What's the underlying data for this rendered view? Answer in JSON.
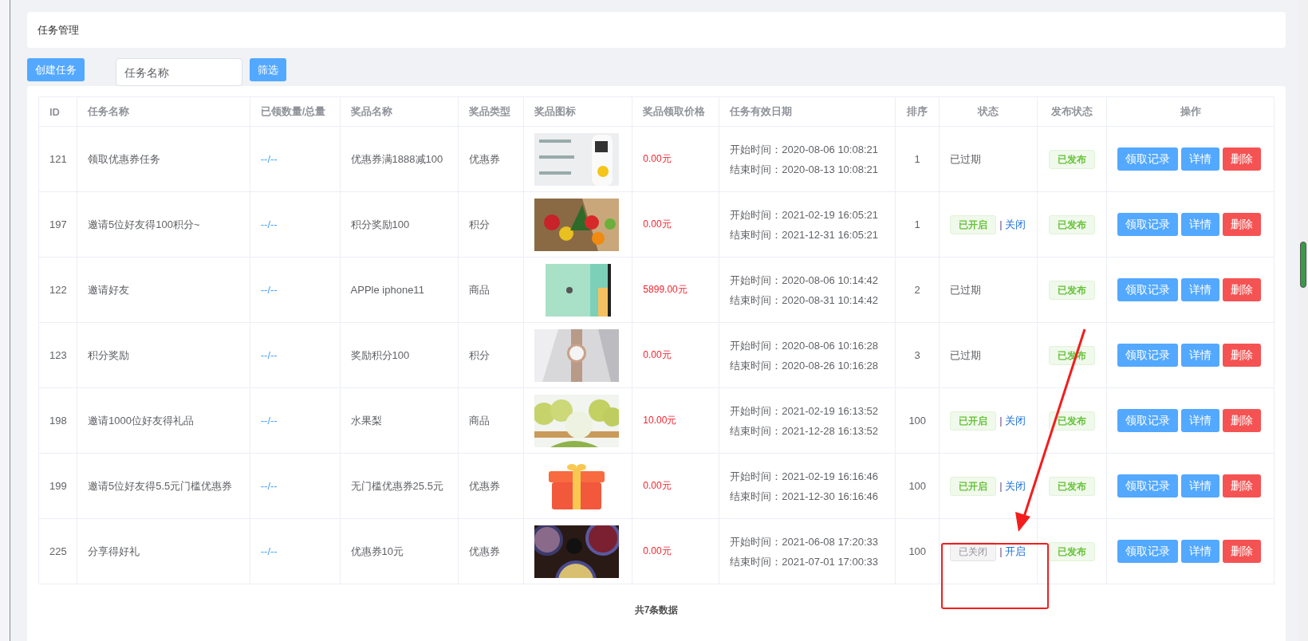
{
  "page_title": "任务管理",
  "toolbar": {
    "create_button": "创建任务",
    "search": {
      "placeholder": "任务名称"
    },
    "filter_button": "筛选"
  },
  "table": {
    "columns": [
      "ID",
      "任务名称",
      "已领数量/总量",
      "奖品名称",
      "奖品类型",
      "奖品图标",
      "奖品领取价格",
      "任务有效日期",
      "排序",
      "状态",
      "发布状态",
      "操作"
    ],
    "rows": [
      {
        "id": "121",
        "name": "领取优惠券任务",
        "claimed": "--/--",
        "prize": "优惠券满1888减100",
        "prize_type": "优惠券",
        "price": "0.00元",
        "start": "开始时间：2020-08-06 10:08:21",
        "end": "结束时间：2020-08-13 10:08:21",
        "sort": "1",
        "status": {
          "kind": "expired",
          "label": "已过期"
        },
        "publish": "已发布",
        "actions": [
          {
            "label": "领取记录",
            "kind": "primary"
          },
          {
            "label": "详情",
            "kind": "primary"
          },
          {
            "label": "删除",
            "kind": "danger"
          }
        ]
      },
      {
        "id": "197",
        "name": "邀请5位好友得100积分~",
        "claimed": "--/--",
        "prize": "积分奖励100",
        "prize_type": "积分",
        "price": "0.00元",
        "start": "开始时间：2021-02-19 16:05:21",
        "end": "结束时间：2021-12-31 16:05:21",
        "sort": "1",
        "status": {
          "kind": "open",
          "label": "已开启",
          "separator": "|",
          "toggle": "关闭"
        },
        "publish": "已发布",
        "actions": [
          {
            "label": "领取记录",
            "kind": "primary"
          },
          {
            "label": "详情",
            "kind": "primary"
          },
          {
            "label": "删除",
            "kind": "danger"
          }
        ]
      },
      {
        "id": "122",
        "name": "邀请好友",
        "claimed": "--/--",
        "prize": "APPle iphone11",
        "prize_type": "商品",
        "price": "5899.00元",
        "start": "开始时间：2020-08-06 10:14:42",
        "end": "结束时间：2020-08-31 10:14:42",
        "sort": "2",
        "status": {
          "kind": "expired",
          "label": "已过期"
        },
        "publish": "已发布",
        "actions": [
          {
            "label": "领取记录",
            "kind": "primary"
          },
          {
            "label": "详情",
            "kind": "primary"
          },
          {
            "label": "删除",
            "kind": "danger"
          }
        ]
      },
      {
        "id": "123",
        "name": "积分奖励",
        "claimed": "--/--",
        "prize": "奖励积分100",
        "prize_type": "积分",
        "price": "0.00元",
        "start": "开始时间：2020-08-06 10:16:28",
        "end": "结束时间：2020-08-26 10:16:28",
        "sort": "3",
        "status": {
          "kind": "expired",
          "label": "已过期"
        },
        "publish": "已发布",
        "actions": [
          {
            "label": "领取记录",
            "kind": "primary"
          },
          {
            "label": "详情",
            "kind": "primary"
          },
          {
            "label": "删除",
            "kind": "danger"
          }
        ]
      },
      {
        "id": "198",
        "name": "邀请1000位好友得礼品",
        "claimed": "--/--",
        "prize": "水果梨",
        "prize_type": "商品",
        "price": "10.00元",
        "start": "开始时间：2021-02-19 16:13:52",
        "end": "结束时间：2021-12-28 16:13:52",
        "sort": "100",
        "status": {
          "kind": "open",
          "label": "已开启",
          "separator": "|",
          "toggle": "关闭"
        },
        "publish": "已发布",
        "actions": [
          {
            "label": "领取记录",
            "kind": "primary"
          },
          {
            "label": "详情",
            "kind": "primary"
          },
          {
            "label": "删除",
            "kind": "danger"
          }
        ]
      },
      {
        "id": "199",
        "name": "邀请5位好友得5.5元门槛优惠券",
        "claimed": "--/--",
        "prize": "无门槛优惠券25.5元",
        "prize_type": "优惠券",
        "price": "0.00元",
        "start": "开始时间：2021-02-19 16:16:46",
        "end": "结束时间：2021-12-30 16:16:46",
        "sort": "100",
        "status": {
          "kind": "open",
          "label": "已开启",
          "separator": "|",
          "toggle": "关闭"
        },
        "publish": "已发布",
        "actions": [
          {
            "label": "领取记录",
            "kind": "primary"
          },
          {
            "label": "详情",
            "kind": "primary"
          },
          {
            "label": "删除",
            "kind": "danger"
          }
        ]
      },
      {
        "id": "225",
        "name": "分享得好礼",
        "claimed": "--/--",
        "prize": "优惠券10元",
        "prize_type": "优惠券",
        "price": "0.00元",
        "start": "开始时间：2021-06-08 17:20:33",
        "end": "结束时间：2021-07-01 17:00:33",
        "sort": "100",
        "status": {
          "kind": "closed",
          "label": "已关闭",
          "separator": "|",
          "toggle": "开启"
        },
        "publish": "已发布",
        "actions": [
          {
            "label": "领取记录",
            "kind": "primary"
          },
          {
            "label": "详情",
            "kind": "primary"
          },
          {
            "label": "删除",
            "kind": "danger"
          }
        ]
      }
    ]
  },
  "footer": "共7条数据"
}
